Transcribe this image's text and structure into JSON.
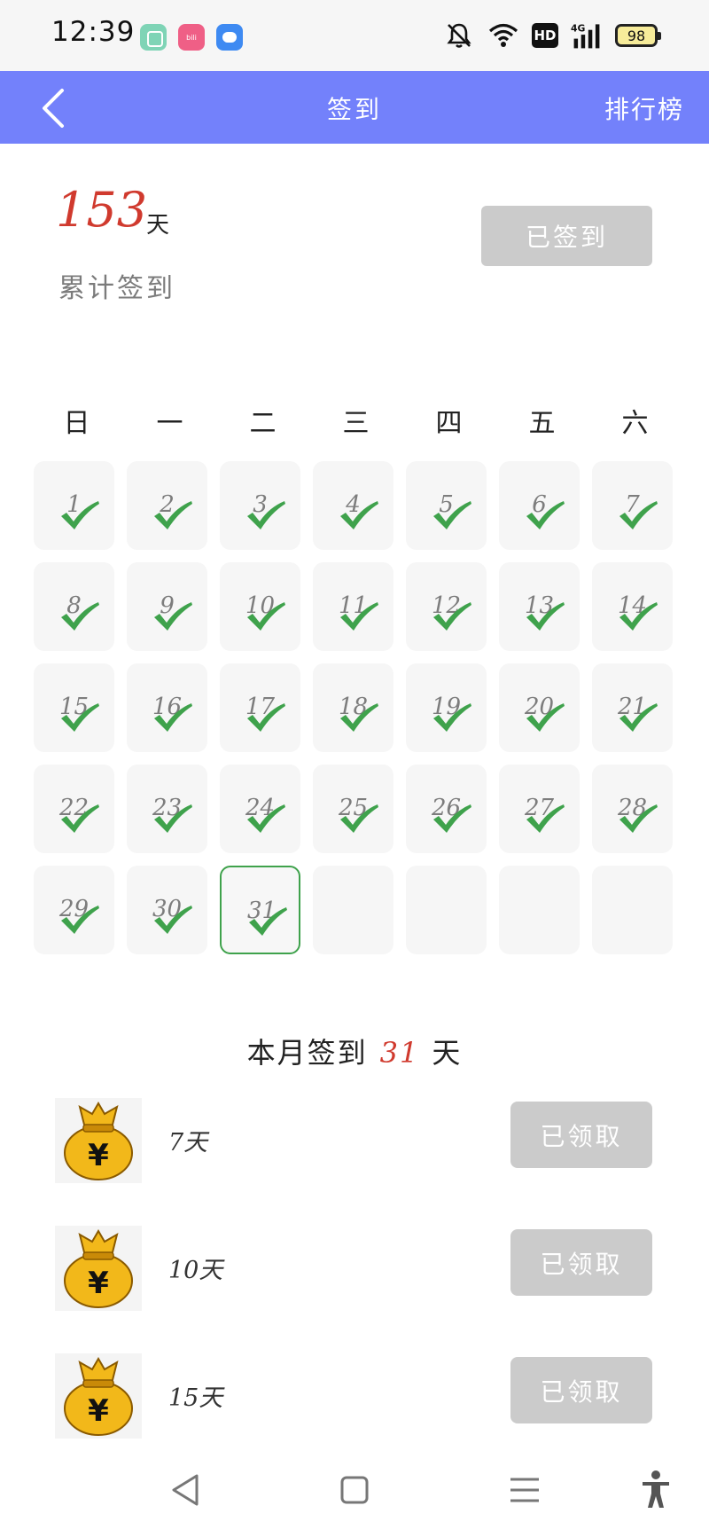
{
  "status_bar": {
    "time": "12:39",
    "apps": [
      "app-green-icon",
      "app-pink-icon",
      "app-blue-icon"
    ],
    "pink_app_text": "bili",
    "hd": "HD",
    "network": "4G",
    "battery": "98"
  },
  "header": {
    "title": "签到",
    "rank": "排行榜",
    "color": "#7381fb"
  },
  "summary": {
    "total_days": "153",
    "unit": "天",
    "label": "累计签到",
    "signed_button": "已签到"
  },
  "calendar": {
    "weekdays": [
      "日",
      "一",
      "二",
      "三",
      "四",
      "五",
      "六"
    ],
    "days": [
      {
        "n": "1",
        "checked": true
      },
      {
        "n": "2",
        "checked": true
      },
      {
        "n": "3",
        "checked": true
      },
      {
        "n": "4",
        "checked": true
      },
      {
        "n": "5",
        "checked": true
      },
      {
        "n": "6",
        "checked": true
      },
      {
        "n": "7",
        "checked": true
      },
      {
        "n": "8",
        "checked": true
      },
      {
        "n": "9",
        "checked": true
      },
      {
        "n": "10",
        "checked": true
      },
      {
        "n": "11",
        "checked": true
      },
      {
        "n": "12",
        "checked": true
      },
      {
        "n": "13",
        "checked": true
      },
      {
        "n": "14",
        "checked": true
      },
      {
        "n": "15",
        "checked": true
      },
      {
        "n": "16",
        "checked": true
      },
      {
        "n": "17",
        "checked": true
      },
      {
        "n": "18",
        "checked": true
      },
      {
        "n": "19",
        "checked": true
      },
      {
        "n": "20",
        "checked": true
      },
      {
        "n": "21",
        "checked": true
      },
      {
        "n": "22",
        "checked": true
      },
      {
        "n": "23",
        "checked": true
      },
      {
        "n": "24",
        "checked": true
      },
      {
        "n": "25",
        "checked": true
      },
      {
        "n": "26",
        "checked": true
      },
      {
        "n": "27",
        "checked": true
      },
      {
        "n": "28",
        "checked": true
      },
      {
        "n": "29",
        "checked": true
      },
      {
        "n": "30",
        "checked": true
      },
      {
        "n": "31",
        "checked": true,
        "today": true
      },
      {
        "n": "",
        "checked": false
      },
      {
        "n": "",
        "checked": false
      },
      {
        "n": "",
        "checked": false
      },
      {
        "n": "",
        "checked": false
      }
    ],
    "check_color": "#3fa24c"
  },
  "month": {
    "prefix": "本月签到",
    "count": "31",
    "suffix": "天"
  },
  "rewards": [
    {
      "label": "7天",
      "button": "已领取"
    },
    {
      "label": "10天",
      "button": "已领取"
    },
    {
      "label": "15天",
      "button": "已领取"
    }
  ],
  "nav": [
    "back-triangle-icon",
    "home-square-icon",
    "menu-lines-icon",
    "accessibility-icon"
  ]
}
